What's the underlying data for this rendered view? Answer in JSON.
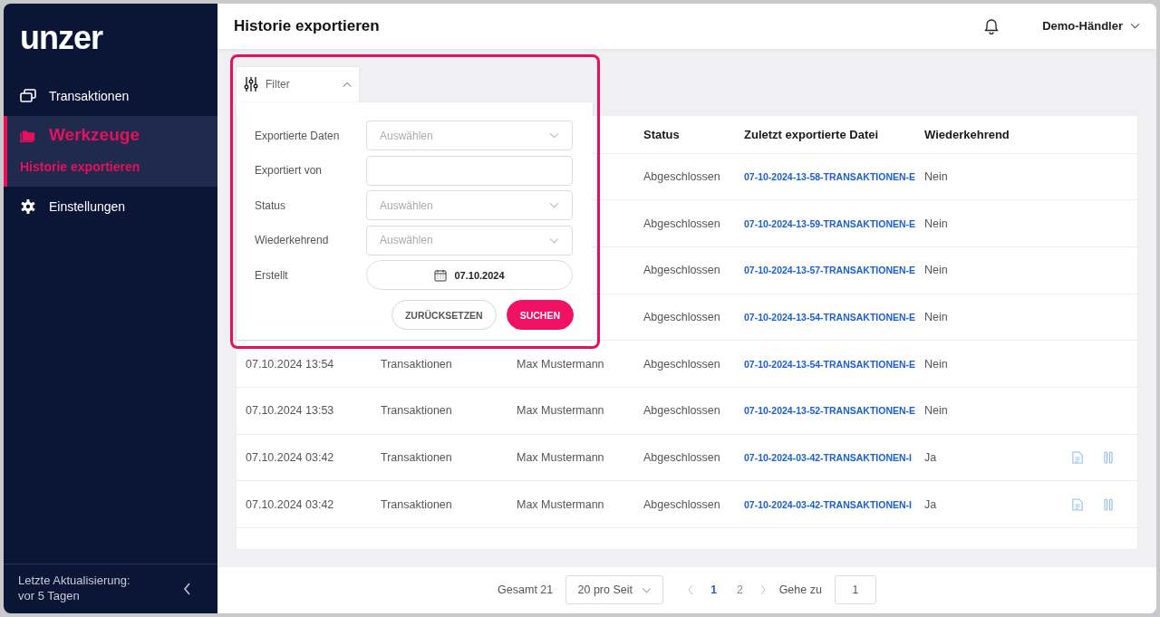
{
  "sidebar": {
    "logo": "unzer",
    "items": [
      {
        "label": "Transaktionen",
        "selected": false,
        "kind": "item"
      },
      {
        "label": "Werkzeuge",
        "selected": true,
        "kind": "group",
        "children": [
          {
            "label": "Historie exportieren",
            "selected": true
          }
        ]
      },
      {
        "label": "Einstellungen",
        "selected": false,
        "kind": "item"
      }
    ],
    "footer": "Letzte Aktualisierung: vor 5 Tagen"
  },
  "header": {
    "title": "Historie exportieren",
    "user": "Demo-Händler"
  },
  "filter": {
    "tab": "Filter",
    "expanded": true,
    "fields": [
      {
        "label": "Exportierte Daten",
        "kind": "select",
        "placeholder": "Auswählen"
      },
      {
        "label": "Exportiert von",
        "kind": "text"
      },
      {
        "label": "Status",
        "kind": "select",
        "placeholder": "Auswählen"
      },
      {
        "label": "Wiederkehrend",
        "kind": "select",
        "placeholder": "Auswählen"
      },
      {
        "label": "Erstellt",
        "kind": "date",
        "value": "07.10.2024"
      }
    ],
    "buttons": [
      "ZURÜCKSETZEN",
      "SUCHEN"
    ]
  },
  "table": {
    "columns": [
      "Status",
      "Zuletzt exportierte Datei",
      "Wiederkehrend"
    ],
    "rows": [
      {
        "status": "Abgeschlossen",
        "file": "07-10-2024-13-58-TRANSAKTIONEN-E",
        "recurring": "Nein",
        "actions": false
      },
      {
        "status": "Abgeschlossen",
        "file": "07-10-2024-13-59-TRANSAKTIONEN-E",
        "recurring": "Nein",
        "actions": false
      },
      {
        "status": "Abgeschlossen",
        "file": "07-10-2024-13-57-TRANSAKTIONEN-E",
        "recurring": "Nein",
        "actions": false
      },
      {
        "status": "Abgeschlossen",
        "file": "07-10-2024-13-54-TRANSAKTIONEN-E",
        "recurring": "Nein",
        "actions": false
      },
      {
        "date": "07.10.2024 13:54",
        "type": "Transaktionen",
        "user": "Max Mustermann",
        "status": "Abgeschlossen",
        "file": "07-10-2024-13-54-TRANSAKTIONEN-E",
        "recurring": "Nein",
        "actions": false
      },
      {
        "date": "07.10.2024 13:53",
        "type": "Transaktionen",
        "user": "Max Mustermann",
        "status": "Abgeschlossen",
        "file": "07-10-2024-13-52-TRANSAKTIONEN-E",
        "recurring": "Nein",
        "actions": false
      },
      {
        "date": "07.10.2024 03:42",
        "type": "Transaktionen",
        "user": "Max Mustermann",
        "status": "Abgeschlossen",
        "file": "07-10-2024-03-42-TRANSAKTIONEN-I",
        "recurring": "Ja",
        "actions": true
      },
      {
        "date": "07.10.2024 03:42",
        "type": "Transaktionen",
        "user": "Max Mustermann",
        "status": "Abgeschlossen",
        "file": "07-10-2024-03-42-TRANSAKTIONEN-I",
        "recurring": "Ja",
        "actions": true
      }
    ]
  },
  "pagination": {
    "total": "Gesamt 21",
    "page_size": "20 pro Seit",
    "pages": [
      {
        "label": "1",
        "selected": true
      },
      {
        "label": "2",
        "selected": false
      }
    ],
    "goto_label": "Gehe zu",
    "goto_value": "1"
  }
}
